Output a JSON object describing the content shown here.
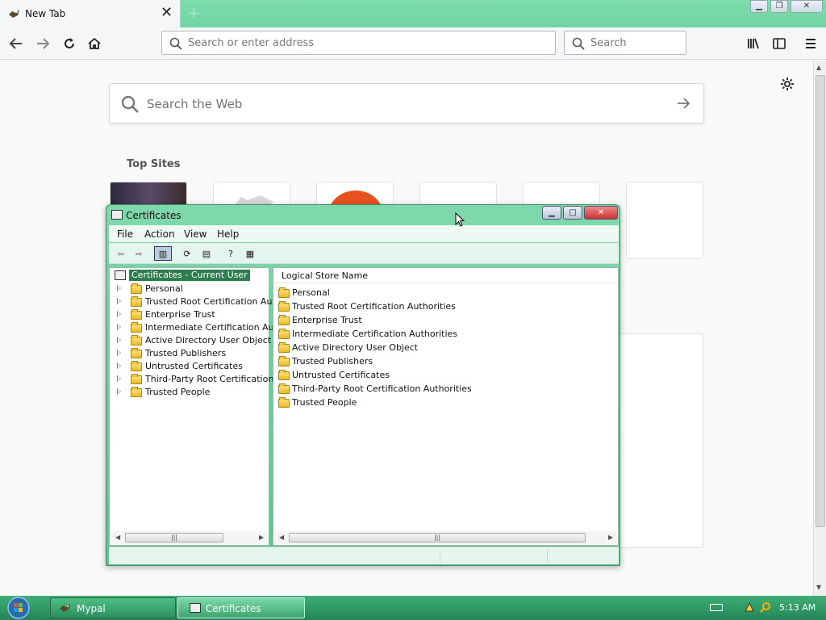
{
  "browser": {
    "tab_title": "New Tab",
    "address_placeholder": "Search or enter address",
    "search_placeholder": "Search"
  },
  "newtab": {
    "web_search_placeholder": "Search the Web",
    "top_sites_title": "Top Sites"
  },
  "certificates_window": {
    "title": "Certificates",
    "menu": [
      "File",
      "Action",
      "View",
      "Help"
    ],
    "tree_root": "Certificates - Current User",
    "tree_items": [
      "Personal",
      "Trusted Root Certification Aut",
      "Enterprise Trust",
      "Intermediate Certification Aut",
      "Active Directory User Object",
      "Trusted Publishers",
      "Untrusted Certificates",
      "Third-Party Root Certification",
      "Trusted People"
    ],
    "list_header": "Logical Store Name",
    "list_items": [
      "Personal",
      "Trusted Root Certification Authorities",
      "Enterprise Trust",
      "Intermediate Certification Authorities",
      "Active Directory User Object",
      "Trusted Publishers",
      "Untrusted Certificates",
      "Third-Party Root Certification Authorities",
      "Trusted People"
    ]
  },
  "taskbar": {
    "tasks": [
      "Mypal",
      "Certificates"
    ],
    "clock": "5:13 AM"
  },
  "icons": {
    "back": "back-arrow-icon",
    "forward": "forward-arrow-icon",
    "reload": "reload-icon",
    "home": "home-icon",
    "library": "library-icon",
    "sidebar": "sidebar-icon",
    "menu": "hamburger-menu-icon",
    "settings": "gear-icon"
  },
  "colors": {
    "accent": "#6fd4a3",
    "taskbar": "#2f9a66",
    "tree_selected": "#2e7d4f"
  }
}
